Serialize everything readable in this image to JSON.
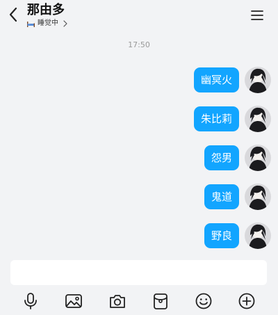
{
  "header": {
    "title": "那由多",
    "status": "睡觉中"
  },
  "timestamp": "17:50",
  "messages": [
    {
      "text": "幽冥火"
    },
    {
      "text": "朱比莉"
    },
    {
      "text": "怨男"
    },
    {
      "text": "鬼道"
    },
    {
      "text": "野良"
    }
  ],
  "input": {
    "value": ""
  },
  "toolbar": {
    "items": [
      "mic-icon",
      "image-icon",
      "camera-icon",
      "red-packet-icon",
      "emoji-icon",
      "plus-icon"
    ]
  },
  "colors": {
    "bubble": "#12a5ff",
    "background": "#f2f3f5"
  }
}
